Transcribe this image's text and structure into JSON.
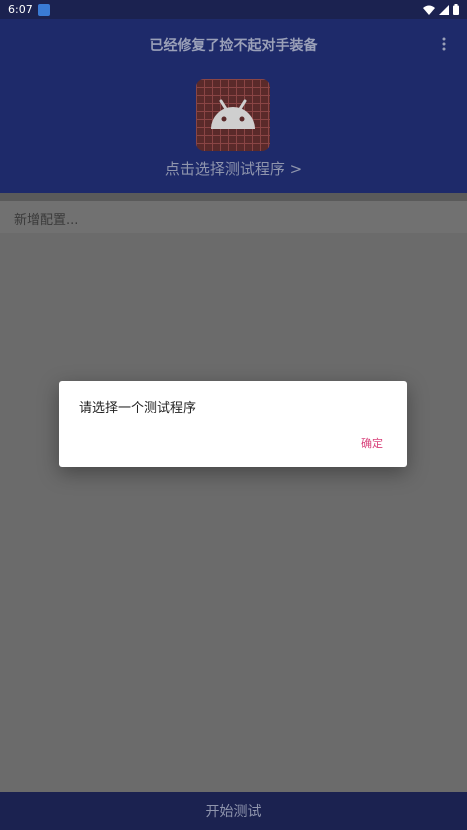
{
  "status_bar": {
    "time": "6:07",
    "icons": [
      "notification-app-icon",
      "wifi-icon",
      "signal-icon",
      "battery-icon"
    ]
  },
  "header": {
    "title": "已经修复了捡不起对手装备",
    "pick_program_label": "点击选择测试程序 >",
    "more_icon": "more-vertical-icon"
  },
  "list": {
    "new_config_label": "新增配置..."
  },
  "dialog": {
    "message": "请选择一个测试程序",
    "ok_label": "确定"
  },
  "bottom": {
    "start_label": "开始测试"
  },
  "colors": {
    "header_bg": "#1e2a6a",
    "bar_bg": "#1b2250",
    "scrim": "#6b6b6b",
    "accent": "#d8407a"
  }
}
